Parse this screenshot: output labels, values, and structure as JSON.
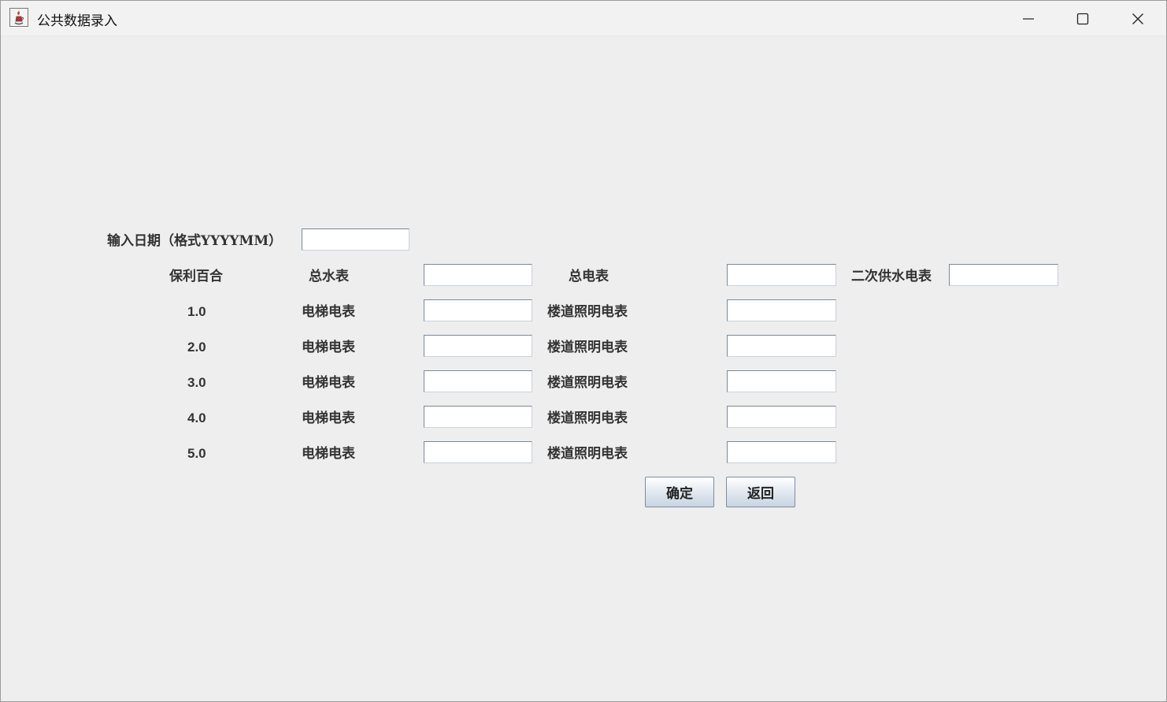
{
  "window": {
    "title": "公共数据录入",
    "controls": [
      "minimize",
      "maximize",
      "close"
    ]
  },
  "date": {
    "label": "输入日期（格式YYYYMM）",
    "value": ""
  },
  "header": {
    "community": "保利百合",
    "total_water": "总水表",
    "total_water_value": "",
    "total_electric": "总电表",
    "total_electric_value": "",
    "secondary_pump": "二次供水电表",
    "secondary_pump_value": ""
  },
  "rows": [
    {
      "building": "1.0",
      "elevator_label": "电梯电表",
      "elevator_value": "",
      "lighting_label": "楼道照明电表",
      "lighting_value": ""
    },
    {
      "building": "2.0",
      "elevator_label": "电梯电表",
      "elevator_value": "",
      "lighting_label": "楼道照明电表",
      "lighting_value": ""
    },
    {
      "building": "3.0",
      "elevator_label": "电梯电表",
      "elevator_value": "",
      "lighting_label": "楼道照明电表",
      "lighting_value": ""
    },
    {
      "building": "4.0",
      "elevator_label": "电梯电表",
      "elevator_value": "",
      "lighting_label": "楼道照明电表",
      "lighting_value": ""
    },
    {
      "building": "5.0",
      "elevator_label": "电梯电表",
      "elevator_value": "",
      "lighting_label": "楼道照明电表",
      "lighting_value": ""
    }
  ],
  "buttons": {
    "confirm": "确定",
    "back": "返回"
  },
  "icons": {
    "app": "java-cup-icon",
    "minimize": "minimize-icon",
    "maximize": "maximize-icon",
    "close": "close-icon"
  }
}
